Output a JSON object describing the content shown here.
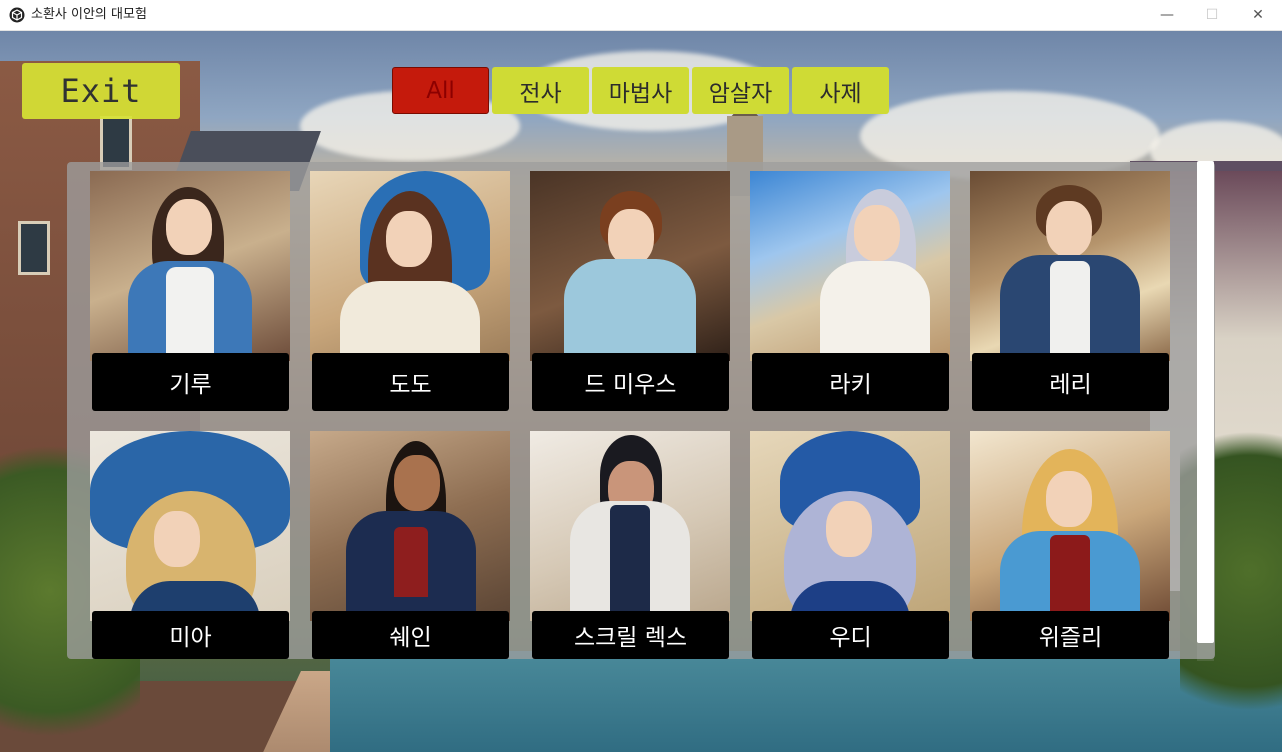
{
  "window": {
    "title": "소환사 이안의 대모험",
    "minimize_glyph": "—",
    "maximize_glyph": "☐",
    "close_glyph": "✕",
    "icon": "app-cube-icon"
  },
  "exit_button": {
    "label": "Exit"
  },
  "filter_tabs": [
    {
      "label": "All",
      "active": true
    },
    {
      "label": "전사",
      "active": false
    },
    {
      "label": "마법사",
      "active": false
    },
    {
      "label": "암살자",
      "active": false
    },
    {
      "label": "사제",
      "active": false
    }
  ],
  "characters": [
    {
      "name": "기루"
    },
    {
      "name": "도도"
    },
    {
      "name": "드 미우스"
    },
    {
      "name": "라키"
    },
    {
      "name": "레리"
    },
    {
      "name": "미아"
    },
    {
      "name": "쉐인"
    },
    {
      "name": "스크릴 렉스"
    },
    {
      "name": "우디"
    },
    {
      "name": "위즐리"
    }
  ],
  "colors": {
    "exit_button_bg": "#d6e234",
    "tab_bg": "#cfdb35",
    "tab_active_bg": "#c51a0c",
    "name_plate_bg": "#000000",
    "panel_bg": "#9e9e9e"
  }
}
